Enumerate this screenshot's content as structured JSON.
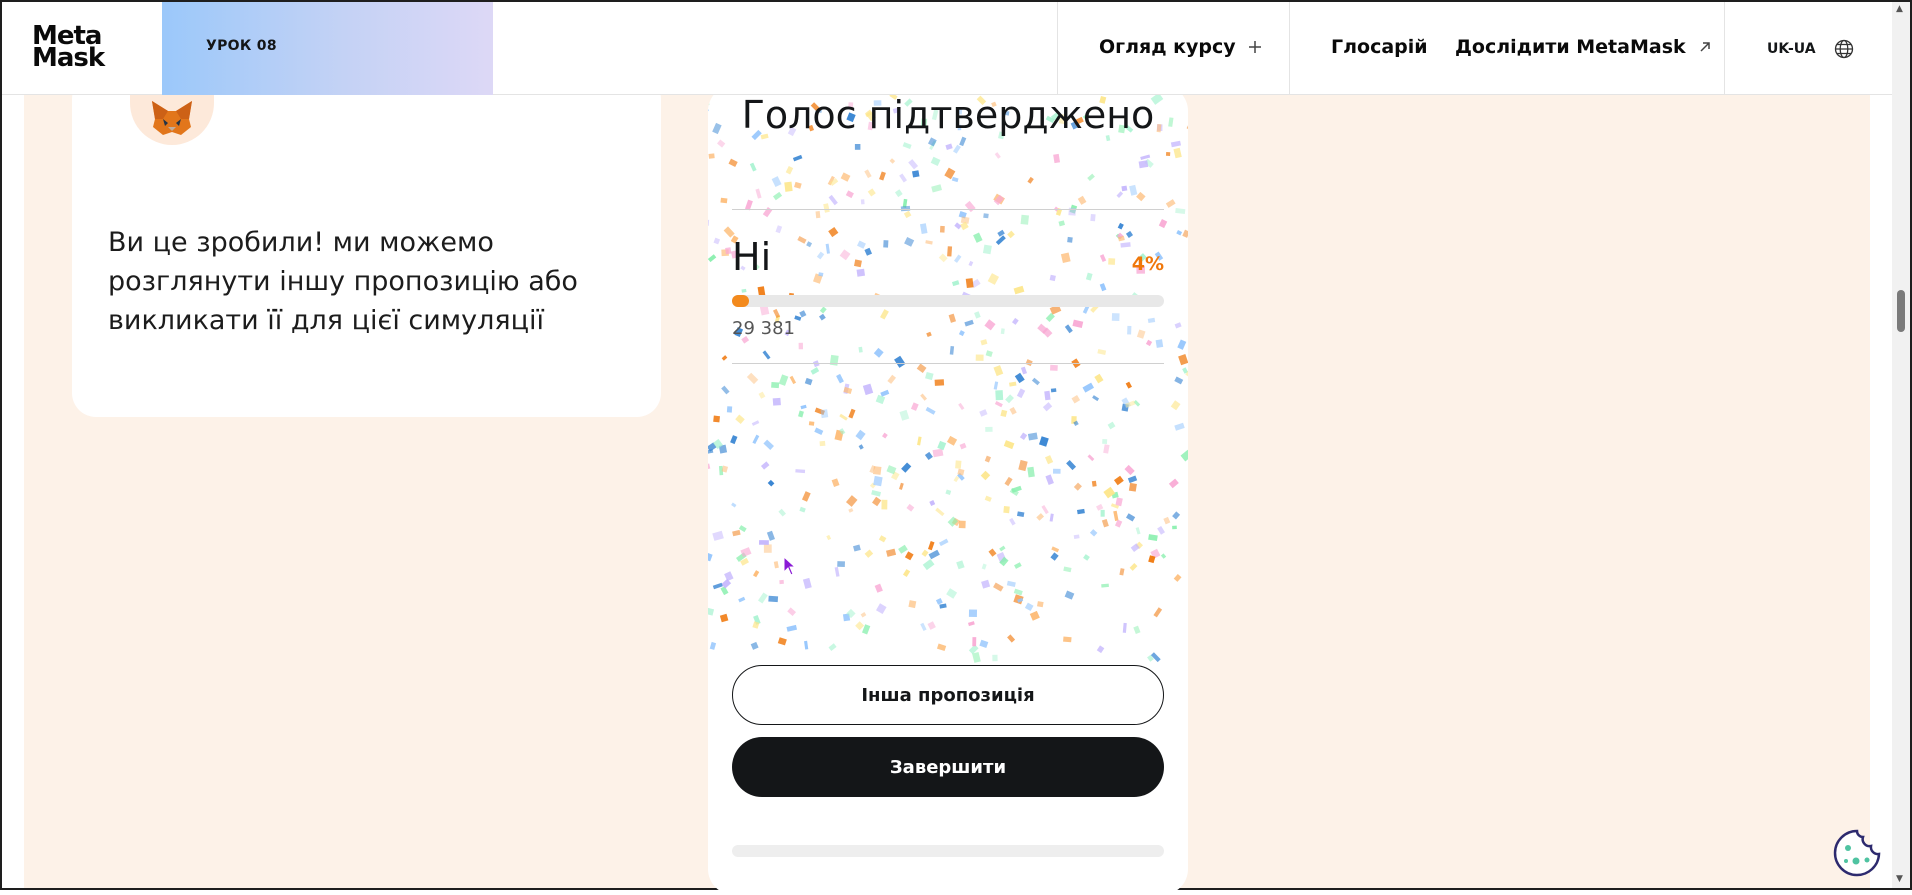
{
  "header": {
    "logo_line1": "Meta",
    "logo_line2": "Mask",
    "lesson": "УРОК 08",
    "nav": {
      "overview": "Огляд курсу",
      "glossary": "Глосарій",
      "explore": "Дослідити MetaMask"
    },
    "language": "UK-UA"
  },
  "card": {
    "text": "Ви це зробили! ми можемо розглянути іншу пропозицію або викликати її для цієї симуляції"
  },
  "vote": {
    "title": "Голос підтверджено",
    "option_label": "Ні",
    "percent_text": "4%",
    "percent_value": 4,
    "votes": "29 381",
    "accent": "#f38a1d"
  },
  "buttons": {
    "other_proposal": "Інша пропозиція",
    "finish": "Завершити"
  },
  "icons": {
    "plus": "plus-icon",
    "external": "arrow-up-right-icon",
    "globe": "globe-icon",
    "fox": "metamask-fox-icon",
    "cookie": "cookie-icon"
  }
}
